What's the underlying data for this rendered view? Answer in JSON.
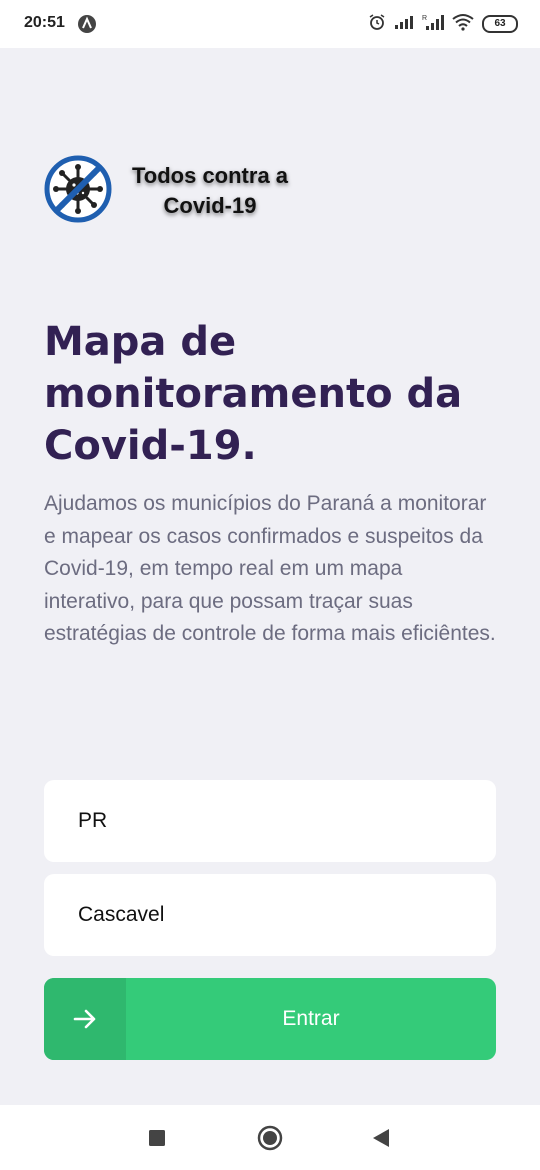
{
  "status": {
    "time": "20:51",
    "battery": "63"
  },
  "logo": {
    "line1": "Todos contra a",
    "line2": "Covid-19"
  },
  "hero": {
    "title": "Mapa de monitoramento da Covid-19.",
    "description": "Ajudamos os municípios do Paraná a monitorar e mapear os casos confirmados e suspeitos da Covid-19, em tempo real em um mapa interativo, para que possam traçar suas estratégias de controle de forma mais eficiêntes."
  },
  "form": {
    "uf_value": "PR",
    "city_value": "Cascavel",
    "submit_label": "Entrar"
  },
  "icons": {
    "submit": "arrow-right-icon",
    "nav_recent": "square-icon",
    "nav_home": "circle-icon",
    "nav_back": "triangle-back-icon"
  },
  "colors": {
    "accent": "#34cb79",
    "title": "#322153",
    "text": "#6c6c80",
    "background": "#f0f0f5"
  }
}
